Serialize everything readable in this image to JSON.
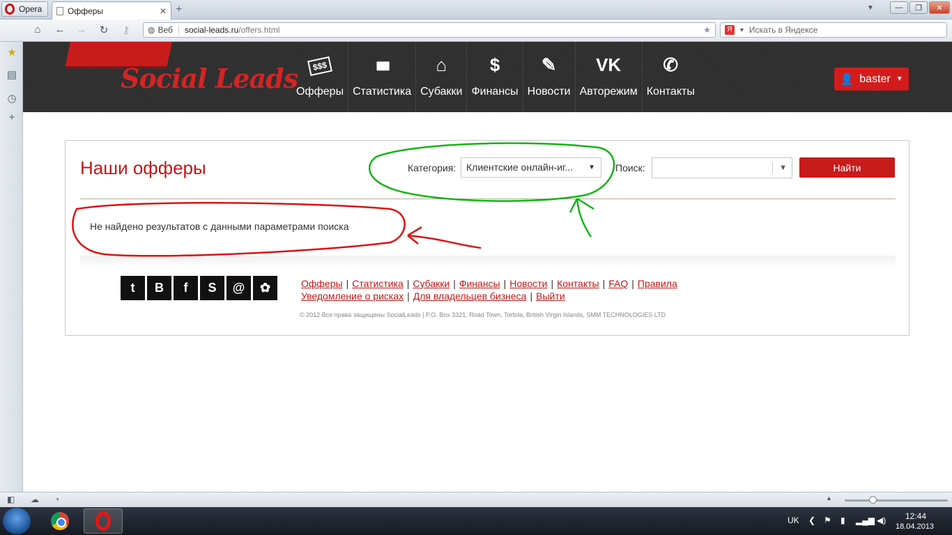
{
  "browser": {
    "menu_label": "Opera",
    "tab_title": "Офферы",
    "tab_close": "✕",
    "new_tab": "+",
    "window_min": "—",
    "window_restore": "❐",
    "window_close": "✕",
    "web_label": "Веб",
    "url_host": "social-leads.ru",
    "url_path": "/offers.html",
    "search_placeholder": "Искать в Яндексе",
    "search_engine_badge": "Я"
  },
  "site": {
    "logo": "Social Leads",
    "menu": [
      {
        "label": "Офферы",
        "icon": "$$$"
      },
      {
        "label": "Статистика",
        "icon": "▮▮▮"
      },
      {
        "label": "Субакки",
        "icon": "⌂"
      },
      {
        "label": "Финансы",
        "icon": "$"
      },
      {
        "label": "Новости",
        "icon": "✎"
      },
      {
        "label": "Авторежим",
        "icon": "VK"
      },
      {
        "label": "Контакты",
        "icon": "✆"
      }
    ],
    "user": {
      "name": "baster",
      "caret": "▼"
    }
  },
  "offers": {
    "title": "Наши офферы",
    "category_label": "Категория:",
    "category_value": "Клиентские онлайн-иг...",
    "search_label": "Поиск:",
    "search_value": "",
    "find_button": "Найти",
    "no_results": "Не найдено результатов с данными параметрами поиска"
  },
  "footer": {
    "social": [
      "t",
      "B",
      "f",
      "S",
      "@",
      "✿"
    ],
    "links_row1": [
      "Офферы",
      "Статистика",
      "Субакки",
      "Финансы",
      "Новости",
      "Контакты",
      "FAQ",
      "Правила"
    ],
    "links_row2": [
      "Уведомление о рисках",
      "Для владельцев бизнеса",
      "Выйти"
    ],
    "copyright": "© 2012 Все права защищены SocialLeads | P.O. Box 3321, Road Town, Tortola, British Virgin Islands, SMM TECHNOLOGIES LTD"
  },
  "taskbar": {
    "language": "UK",
    "time": "12:44",
    "date": "18.04.2013"
  },
  "colors": {
    "brand_red": "#c81b1b",
    "header_dark": "#2e2e2e",
    "annotation_red": "#e01010",
    "annotation_green": "#14b414"
  }
}
